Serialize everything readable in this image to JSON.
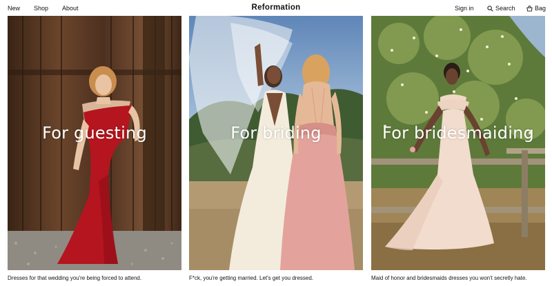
{
  "nav": {
    "left_links": [
      "New",
      "Shop",
      "About"
    ],
    "brand": "Reformation",
    "sign_in": "Sign in",
    "search": "Search",
    "bag": "Bag"
  },
  "panels": [
    {
      "title": "For guesting",
      "caption": "Dresses for that wedding you're being forced to attend."
    },
    {
      "title": "For briding",
      "caption": "F*ck, you're getting married. Let's get you dressed."
    },
    {
      "title": "For bridesmaiding",
      "caption": "Maid of honor and bridesmaids dresses you won't secretly hate."
    }
  ],
  "icons": {
    "search": "search-icon",
    "bag": "bag-icon"
  },
  "colors": {
    "text": "#111111",
    "background": "#ffffff",
    "title_text": "#ffffff"
  }
}
